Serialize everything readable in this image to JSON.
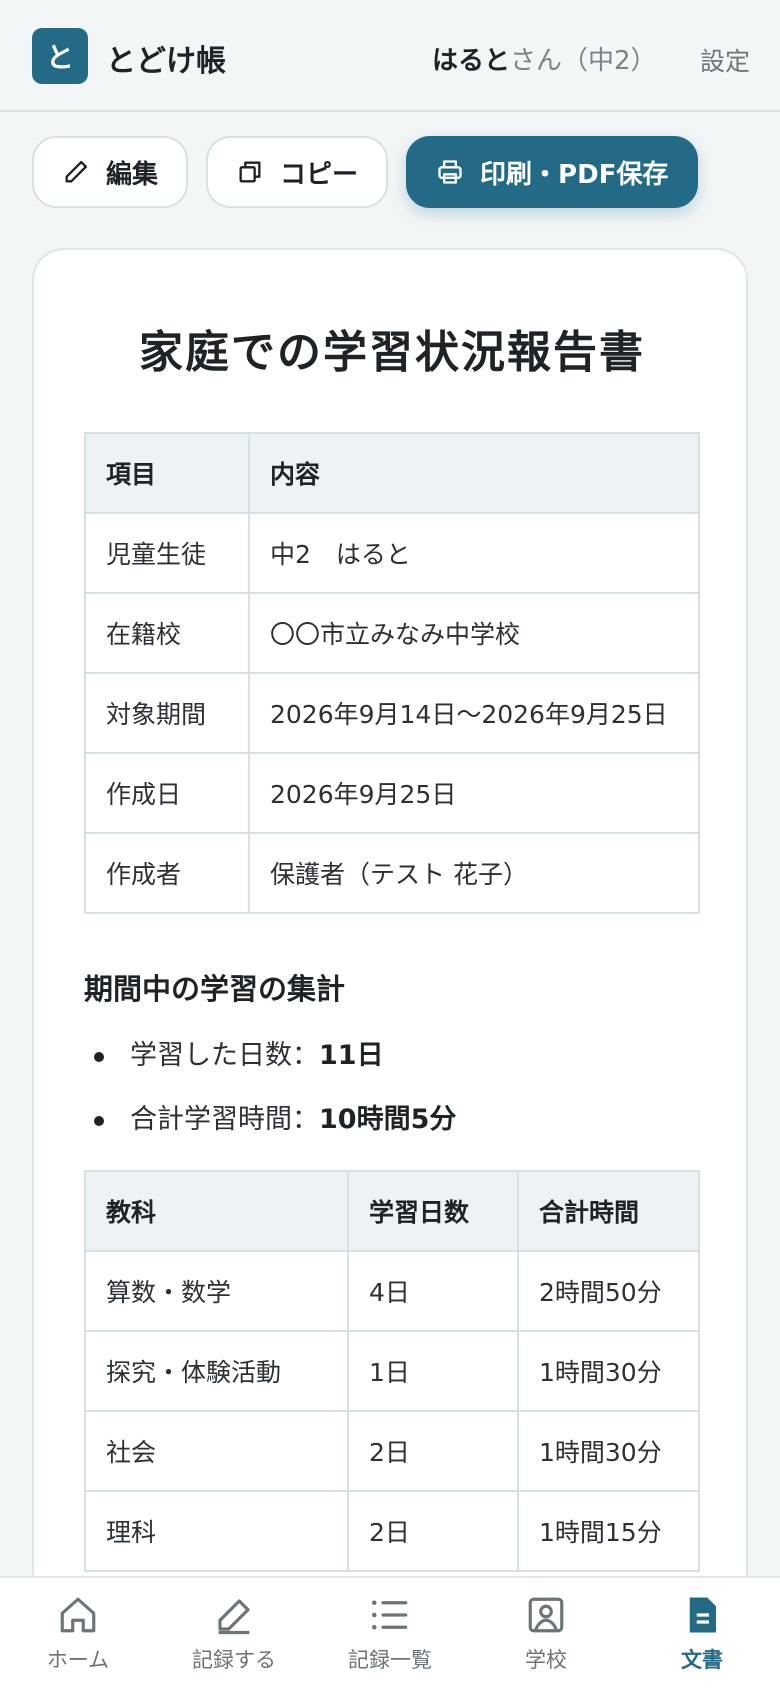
{
  "header": {
    "logo_char": "と",
    "app_name": "とどけ帳",
    "user_name": "はると",
    "user_suffix": "さん（中2）",
    "settings": "設定"
  },
  "toolbar": {
    "edit_label": "編集",
    "copy_label": "コピー",
    "print_label": "印刷・PDF保存"
  },
  "document": {
    "title": "家庭での学習状況報告書",
    "info_table": {
      "headers": [
        "項目",
        "内容"
      ],
      "rows": [
        [
          "児童生徒",
          "中2　はると"
        ],
        [
          "在籍校",
          "〇〇市立みなみ中学校"
        ],
        [
          "対象期間",
          "2026年9月14日〜2026年9月25日"
        ],
        [
          "作成日",
          "2026年9月25日"
        ],
        [
          "作成者",
          "保護者（テスト 花子）"
        ]
      ]
    },
    "summary_heading": "期間中の学習の集計",
    "summary": [
      {
        "label": "学習した日数：",
        "value": "11日"
      },
      {
        "label": "合計学習時間：",
        "value": "10時間5分"
      }
    ],
    "subject_table": {
      "headers": [
        "教科",
        "学習日数",
        "合計時間"
      ],
      "rows": [
        [
          "算数・数学",
          "4日",
          "2時間50分"
        ],
        [
          "探究・体験活動",
          "1日",
          "1時間30分"
        ],
        [
          "社会",
          "2日",
          "1時間30分"
        ],
        [
          "理科",
          "2日",
          "1時間15分"
        ]
      ]
    }
  },
  "bottom_nav": {
    "items": [
      {
        "label": "ホーム",
        "icon": "home-icon"
      },
      {
        "label": "記録する",
        "icon": "pencil-icon"
      },
      {
        "label": "記録一覧",
        "icon": "list-icon"
      },
      {
        "label": "学校",
        "icon": "school-icon"
      },
      {
        "label": "文書",
        "icon": "document-icon"
      }
    ],
    "active_index": 4
  },
  "colors": {
    "accent": "#236a86",
    "background": "#f3f6f7",
    "table_header_bg": "#edf3f5"
  }
}
